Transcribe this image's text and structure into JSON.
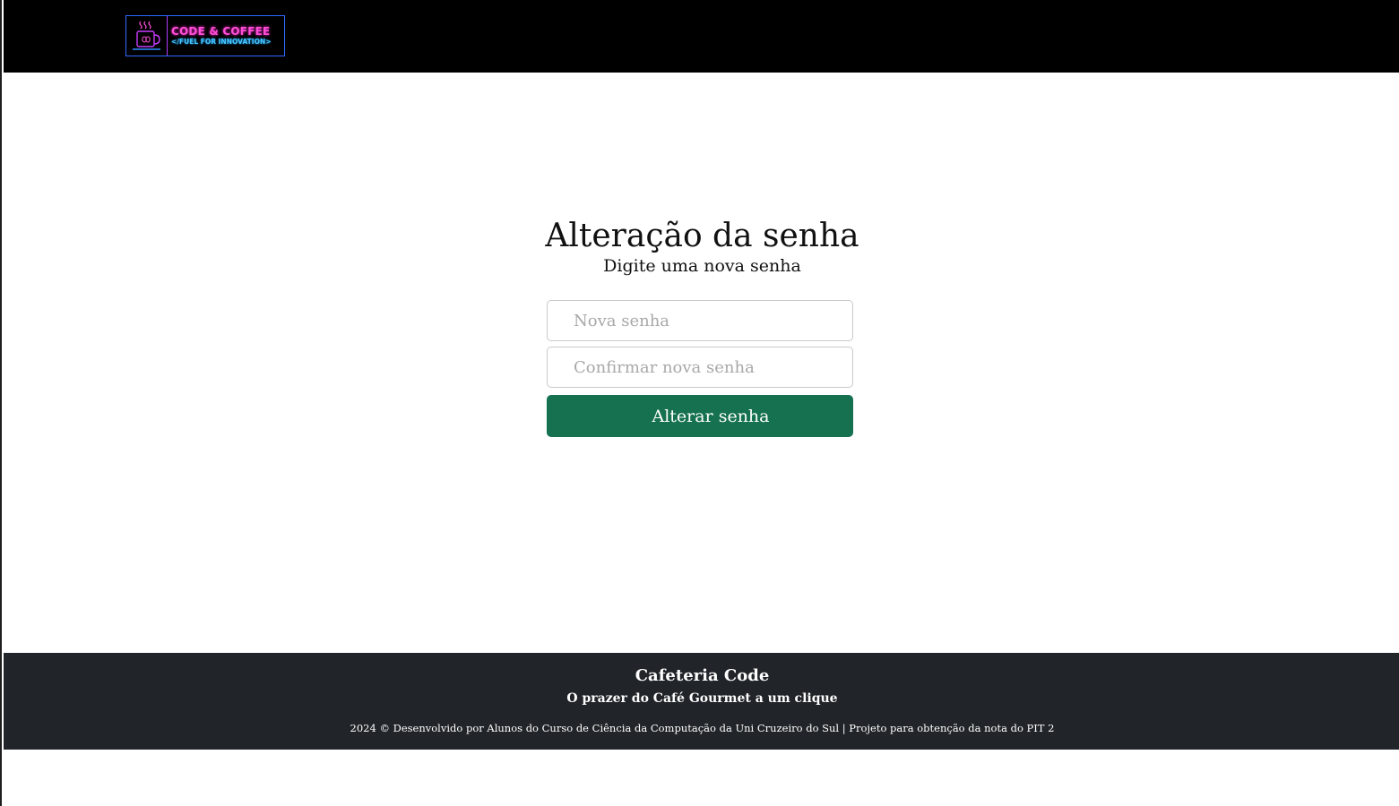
{
  "header": {
    "logo": {
      "title": "CODE & COFFEE",
      "tagline": "</FUEL FOR INNOVATION>",
      "icon": "coffee-cup-icon",
      "colors": {
        "pink": "#ff4fd8",
        "blue": "#46c7ff",
        "purple": "#b23cff"
      }
    }
  },
  "main": {
    "title": "Alteração da senha",
    "subtitle": "Digite uma nova senha",
    "form": {
      "new_password_placeholder": "Nova senha",
      "confirm_password_placeholder": "Confirmar nova senha",
      "submit_label": "Alterar senha",
      "submit_color": "#157150"
    }
  },
  "footer": {
    "title": "Cafeteria Code",
    "tagline": "O prazer do Café Gourmet a um clique",
    "copyright": "2024 © Desenvolvido por Alunos do Curso de Ciência da Computação da Uni Cruzeiro do Sul | Projeto para obtenção da nota do PIT 2",
    "background": "#212529"
  }
}
